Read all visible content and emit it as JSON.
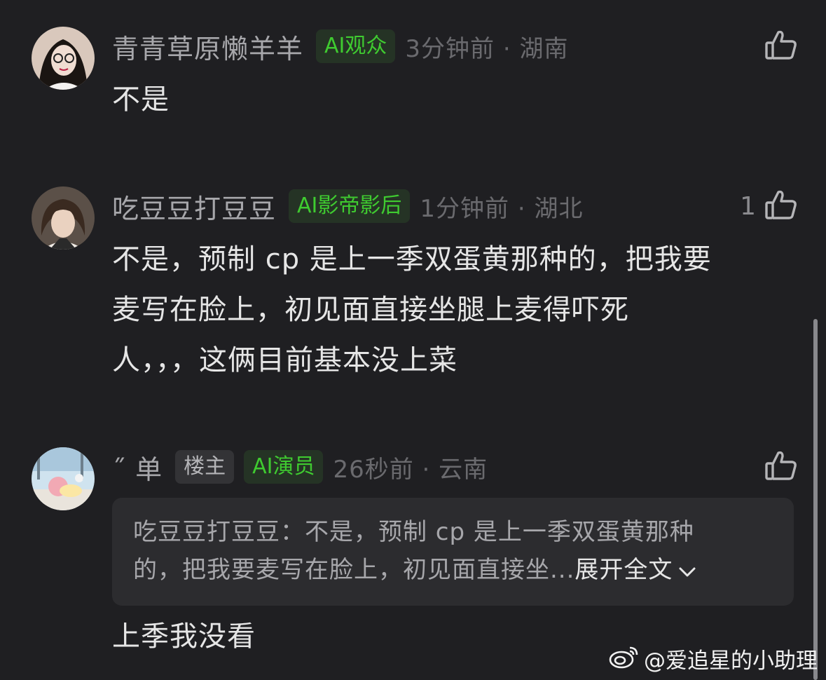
{
  "comments": [
    {
      "username": "青青草原懒羊羊",
      "badges": [
        "AI观众"
      ],
      "time": "3分钟前 · 湖南",
      "text_lines": [
        "不是"
      ],
      "like_count": ""
    },
    {
      "username": "吃豆豆打豆豆",
      "badges": [
        "AI影帝影后"
      ],
      "time": "1分钟前 · 湖北",
      "text_lines": [
        "不是，预制 cp 是上一季双蛋黄那种的，把我要",
        "麦写在脸上，初见面直接坐腿上麦得吓死",
        "人，，，这俩目前基本没上菜"
      ],
      "like_count": "1"
    },
    {
      "username": "˝ 单",
      "owner_badge": "楼主",
      "badges": [
        "AI演员"
      ],
      "time": "26秒前 · 云南",
      "quote": {
        "line1": "吃豆豆打豆豆：不是，预制 cp 是上一季双蛋黄那种",
        "line2": "的，把我要麦写在脸上，初见面直接坐...",
        "expand_label": "展开全文"
      },
      "text_lines": [
        "上季我没看"
      ],
      "like_count": ""
    }
  ],
  "icons": {
    "like": "thumbs-up-icon",
    "expand": "chevron-down-icon",
    "watermark": "weibo-logo-icon"
  },
  "colors": {
    "background": "#1f1f22",
    "badge_green": "#3fcb30",
    "badge_green_bg": "#253325"
  },
  "watermark": {
    "text": "@爱追星的小助理"
  }
}
